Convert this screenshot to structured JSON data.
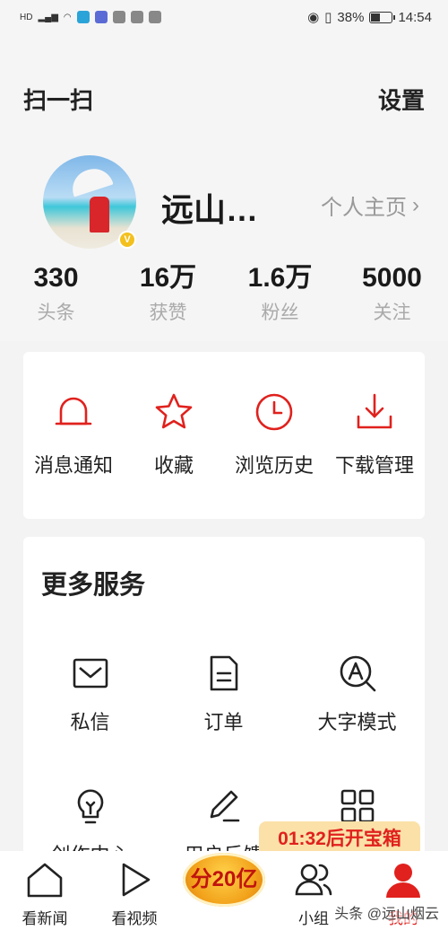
{
  "status_bar": {
    "left_icons": [
      "hd-icon",
      "signal-icon",
      "wifi-icon",
      "search-app-icon",
      "music-app-icon",
      "wechat-icon",
      "cloud-icon",
      "nfc-icon"
    ],
    "battery_percent": "38%",
    "time": "14:54"
  },
  "header": {
    "scan_label": "扫一扫",
    "settings_label": "设置"
  },
  "profile": {
    "username": "远山…",
    "homepage_link": "个人主页",
    "verified_badge": "V",
    "stats": [
      {
        "value": "330",
        "label": "头条"
      },
      {
        "value": "16万",
        "label": "获赞"
      },
      {
        "value": "1.6万",
        "label": "粉丝"
      },
      {
        "value": "5000",
        "label": "关注"
      }
    ]
  },
  "quick_actions": [
    {
      "label": "消息通知",
      "icon": "bell-icon"
    },
    {
      "label": "收藏",
      "icon": "star-icon"
    },
    {
      "label": "浏览历史",
      "icon": "clock-icon"
    },
    {
      "label": "下载管理",
      "icon": "download-icon"
    }
  ],
  "more_services": {
    "title": "更多服务",
    "items": [
      {
        "label": "私信",
        "icon": "mail-icon"
      },
      {
        "label": "订单",
        "icon": "order-icon"
      },
      {
        "label": "大字模式",
        "icon": "big-font-icon"
      },
      {
        "label": "创作中心",
        "icon": "lightbulb-icon"
      },
      {
        "label": "用户反馈",
        "icon": "pen-icon"
      },
      {
        "label": "",
        "icon": "grid-icon"
      }
    ]
  },
  "treasure_banner": "01:32后开宝箱",
  "tab_bar": {
    "items": [
      {
        "label": "看新闻",
        "icon": "home-icon"
      },
      {
        "label": "看视频",
        "icon": "play-icon"
      },
      {
        "label": "分20亿",
        "icon": "gold-coin-icon"
      },
      {
        "label": "小组",
        "icon": "group-icon"
      },
      {
        "label": "我的",
        "icon": "user-icon"
      }
    ]
  },
  "watermark": "头条 @远山烟云",
  "colors": {
    "accent_red": "#e0211d",
    "background": "#f3f3f3"
  }
}
